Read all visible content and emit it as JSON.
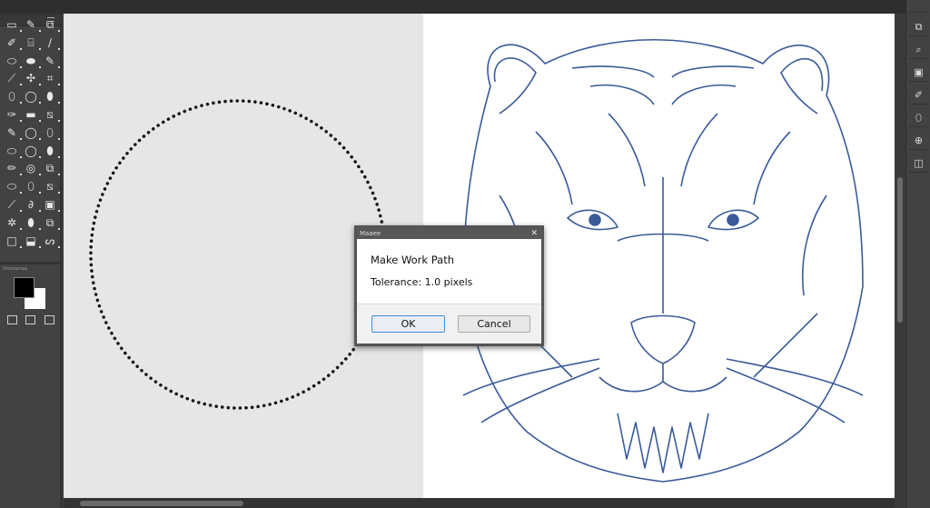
{
  "dialog": {
    "window_title": "Maaee",
    "close_glyph": "✕",
    "heading": "Make Work Path",
    "tolerance": "Tolerance: 1.0 pixels",
    "ok_label": "OK",
    "cancel_label": "Cancel"
  },
  "toolbar": {
    "tools": [
      "marquee",
      "brush",
      "artboard",
      "pencil",
      "stamp",
      "pen",
      "eraser",
      "eraser-alt",
      "pen-alt",
      "eyedropper",
      "puzzle",
      "crop",
      "lasso",
      "ellipse",
      "smudge",
      "dropper",
      "gradient",
      "transform",
      "brush-alt",
      "ellipse-alt",
      "pen-curve",
      "lasso-poly",
      "ellipse-outline",
      "lasso-alt",
      "brush-fill",
      "blur",
      "patch",
      "ellipse-path",
      "pen-path",
      "spot-heal",
      "path",
      "link",
      "image",
      "gear",
      "dodge",
      "crop-alt",
      "rectangle",
      "hand",
      "rotate"
    ],
    "swatch_label": "Umoxpnaa",
    "foreground_color": "#000000",
    "background_color": "#ffffff"
  },
  "right_panel": {
    "buttons": [
      "layers-icon",
      "lasso-icon",
      "artboard-icon",
      "pen-icon",
      "eraser-icon",
      "zoom-icon",
      "properties-icon"
    ]
  },
  "canvas": {
    "left_bg": "#e6e6e6",
    "right_bg": "#ffffff",
    "line_color": "#3a5a9a"
  }
}
